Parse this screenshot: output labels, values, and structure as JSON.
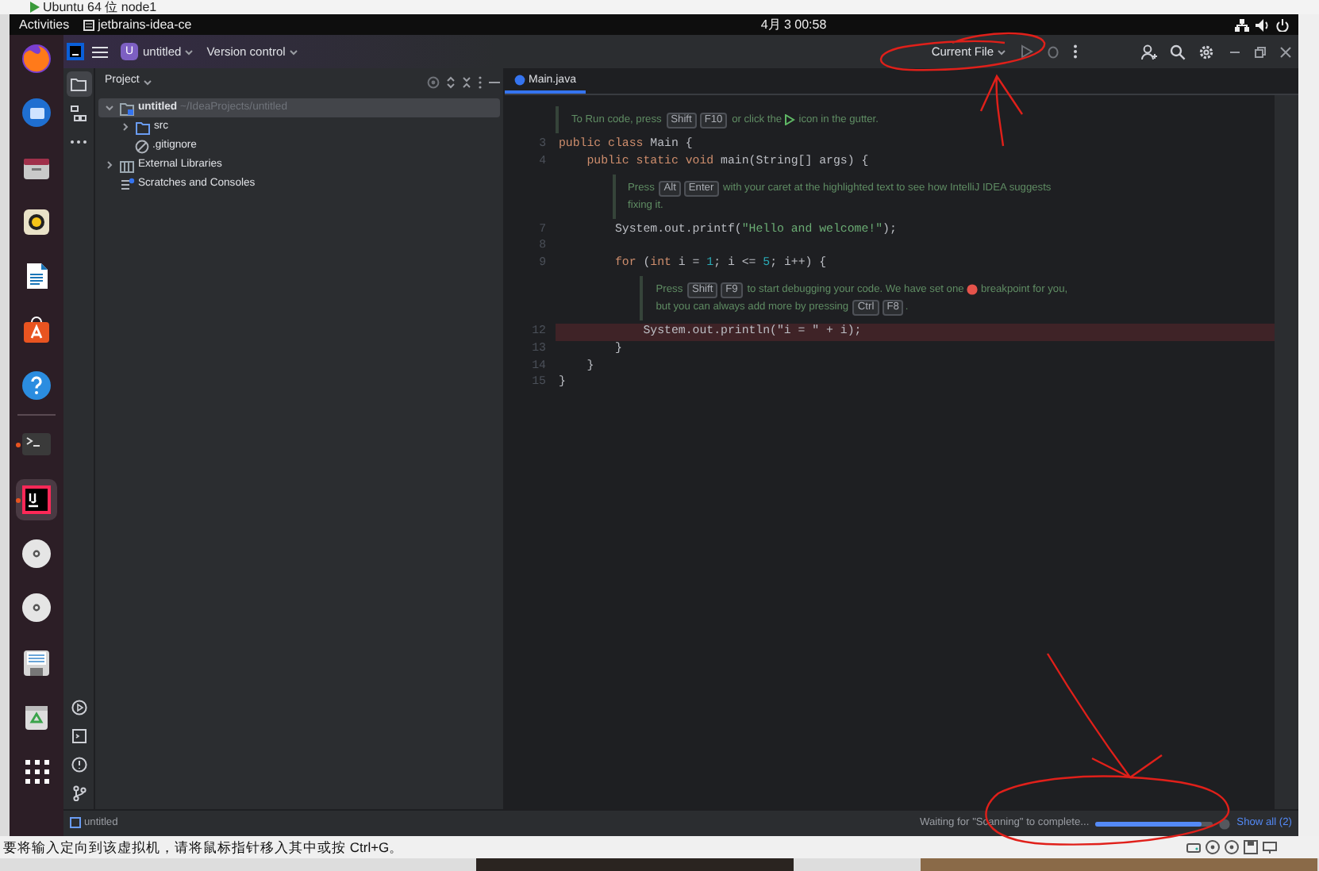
{
  "host_window": {
    "title": "Ubuntu 64 位 node1"
  },
  "top_bar": {
    "activities": "Activities",
    "app_name": "jetbrains-idea-ce",
    "clock": "4月 3  00:58"
  },
  "dock": [
    {
      "kind": "firefox",
      "running": false,
      "selected": false
    },
    {
      "kind": "thunderbird",
      "running": false,
      "selected": false
    },
    {
      "kind": "files",
      "running": false,
      "selected": false
    },
    {
      "kind": "rhythmbox",
      "running": false,
      "selected": false
    },
    {
      "kind": "writer",
      "running": false,
      "selected": false
    },
    {
      "kind": "software",
      "running": false,
      "selected": false
    },
    {
      "kind": "help",
      "running": false,
      "selected": false
    },
    {
      "kind": "separator"
    },
    {
      "kind": "terminal",
      "running": true,
      "selected": false
    },
    {
      "kind": "intellij",
      "running": true,
      "selected": true
    },
    {
      "kind": "disc",
      "running": false,
      "selected": false
    },
    {
      "kind": "disc",
      "running": false,
      "selected": false
    },
    {
      "kind": "floppy",
      "running": false,
      "selected": false
    },
    {
      "kind": "trash",
      "running": false,
      "selected": false
    },
    {
      "kind": "apps",
      "running": false,
      "selected": false
    }
  ],
  "ide": {
    "header": {
      "project_badge": "U",
      "project": "untitled",
      "vcs": "Version control",
      "run_config": "Current File"
    },
    "tool_strip_top": [
      {
        "kind": "project",
        "selected": true
      },
      {
        "kind": "structure",
        "selected": false
      },
      {
        "kind": "more",
        "selected": false
      }
    ],
    "tool_strip_bottom": [
      {
        "kind": "run"
      },
      {
        "kind": "terminal"
      },
      {
        "kind": "problems"
      },
      {
        "kind": "git"
      }
    ],
    "project_panel": {
      "title": "Project",
      "tree": [
        {
          "kind": "module",
          "label": "untitled",
          "path": "~/IdeaProjects/untitled",
          "expanded": true,
          "selected": true,
          "children": [
            {
              "kind": "folder",
              "label": "src",
              "expanded": false,
              "selected": false
            },
            {
              "kind": "file",
              "label": ".gitignore",
              "selected": false
            }
          ]
        },
        {
          "kind": "library",
          "label": "External Libraries",
          "expanded": false,
          "selected": false
        },
        {
          "kind": "scratches",
          "label": "Scratches and Consoles",
          "selected": false
        }
      ]
    },
    "editor": {
      "tabs": [
        {
          "label": "Main.java",
          "selected": true
        }
      ],
      "lines": [
        {
          "kind": "hint",
          "lines": [
            [
              {
                "kind": "text",
                "text": "To Run code, press "
              },
              {
                "kind": "key",
                "text": "Shift"
              },
              {
                "kind": "key",
                "text": "F10"
              },
              {
                "kind": "text",
                "text": " or click the "
              },
              {
                "kind": "run-icon"
              },
              {
                "kind": "text",
                "text": " icon in the gutter."
              }
            ]
          ]
        },
        {
          "kind": "code",
          "number": "3",
          "breakpoint": false,
          "tokens": [
            {
              "kind": "keyword",
              "text": "public class "
            },
            {
              "kind": "plain",
              "text": "Main {"
            }
          ]
        },
        {
          "kind": "code",
          "number": "4",
          "breakpoint": false,
          "tokens": [
            {
              "kind": "keyword",
              "text": "    public static void "
            },
            {
              "kind": "plain",
              "text": "main(String[] args) {"
            }
          ]
        },
        {
          "kind": "hint",
          "lines": [
            [
              {
                "kind": "text",
                "text": "Press "
              },
              {
                "kind": "key",
                "text": "Alt"
              },
              {
                "kind": "key",
                "text": "Enter"
              },
              {
                "kind": "text",
                "text": " with your caret at the highlighted text to see how IntelliJ IDEA suggests"
              }
            ],
            [
              {
                "kind": "text",
                "text": "fixing it."
              }
            ]
          ]
        },
        {
          "kind": "code",
          "number": "7",
          "breakpoint": false,
          "tokens": [
            {
              "kind": "plain",
              "text": "        System.out.printf("
            },
            {
              "kind": "string",
              "text": "\"Hello and welcome!\""
            },
            {
              "kind": "plain",
              "text": ");"
            }
          ]
        },
        {
          "kind": "code",
          "number": "8"
        },
        {
          "kind": "code",
          "number": "9",
          "breakpoint": false,
          "tokens": [
            {
              "kind": "keyword",
              "text": "        for"
            },
            {
              "kind": "plain",
              "text": " ("
            },
            {
              "kind": "keyword",
              "text": "int"
            },
            {
              "kind": "plain",
              "text": " i = "
            },
            {
              "kind": "number",
              "text": "1"
            },
            {
              "kind": "plain",
              "text": "; i <= "
            },
            {
              "kind": "number",
              "text": "5"
            },
            {
              "kind": "plain",
              "text": "; i++) {"
            }
          ]
        },
        {
          "kind": "hint",
          "lines": [
            [
              {
                "kind": "text",
                "text": "Press "
              },
              {
                "kind": "key",
                "text": "Shift"
              },
              {
                "kind": "key",
                "text": "F9"
              },
              {
                "kind": "text",
                "text": " to start debugging your code. We have set one "
              },
              {
                "kind": "dot"
              },
              {
                "kind": "text",
                "text": " breakpoint for you,"
              }
            ],
            [
              {
                "kind": "text",
                "text": "but you can always add more by pressing "
              },
              {
                "kind": "key",
                "text": "Ctrl"
              },
              {
                "kind": "key",
                "text": "F8"
              },
              {
                "kind": "text",
                "text": "."
              }
            ]
          ]
        },
        {
          "kind": "code",
          "number": "12",
          "breakpoint": true,
          "tokens": [
            {
              "kind": "plain",
              "text": "            System.out.println(\"i = \" + i);"
            }
          ]
        },
        {
          "kind": "code",
          "number": "13",
          "breakpoint": false,
          "tokens": [
            {
              "kind": "plain",
              "text": "        }"
            }
          ]
        },
        {
          "kind": "code",
          "number": "14",
          "breakpoint": false,
          "tokens": [
            {
              "kind": "plain",
              "text": "    }"
            }
          ]
        },
        {
          "kind": "code",
          "number": "15",
          "breakpoint": false,
          "tokens": [
            {
              "kind": "plain",
              "text": "}"
            }
          ]
        }
      ]
    },
    "status_bar": {
      "project": "untitled",
      "task": "Waiting for \"Scanning\" to complete...",
      "level": 0.9,
      "link": "Show all (2)"
    }
  },
  "host_status": {
    "message": "要将输入定向到该虚拟机，请将鼠标指针移入其中或按 Ctrl+G。",
    "devices": [
      {
        "kind": "disk"
      },
      {
        "kind": "disc"
      },
      {
        "kind": "disc"
      },
      {
        "kind": "floppy"
      },
      {
        "kind": "network"
      }
    ]
  },
  "annotations": [
    {
      "kind": "scribble",
      "color": "#e0201a"
    },
    {
      "kind": "scribble",
      "color": "#e0201a"
    }
  ]
}
